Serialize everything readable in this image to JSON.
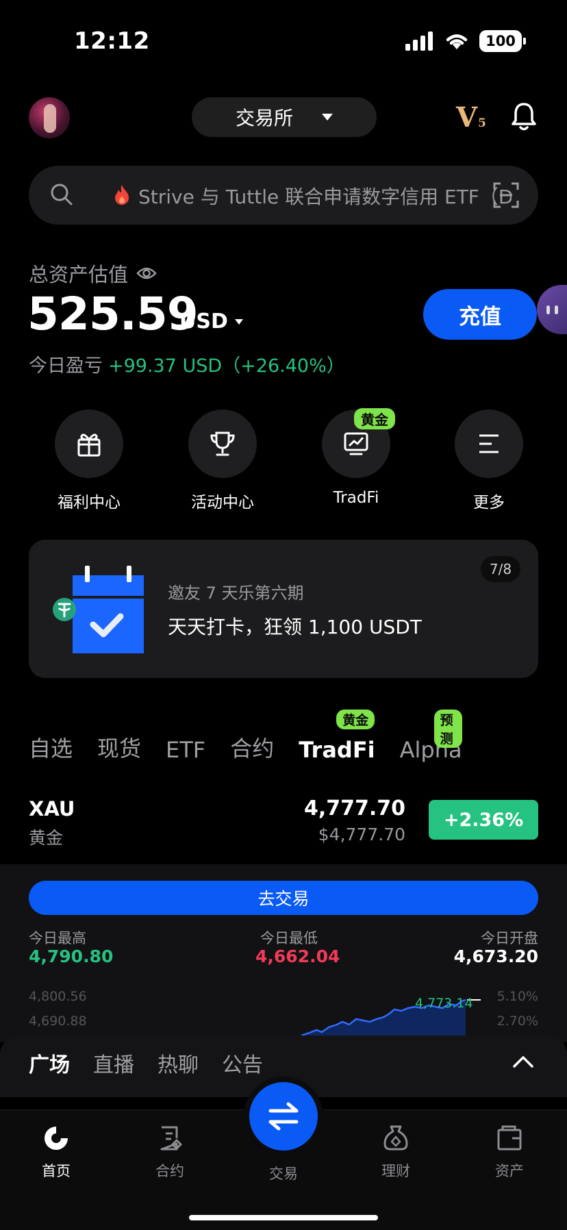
{
  "status_bar": {
    "time": "12:12",
    "battery": "100"
  },
  "header": {
    "mode_label": "交易所",
    "vip_letter": "V",
    "vip_level": "5"
  },
  "search": {
    "text": "Strive 与 Tuttle 联合申请数字信用 ETF（D"
  },
  "assets": {
    "label": "总资产估值",
    "value": "525.59",
    "unit": "USD",
    "pnl_label": "今日盈亏",
    "pnl_value": "+99.37 USD（+26.40%）",
    "deposit_label": "充值"
  },
  "quick_actions": [
    {
      "label": "福利中心",
      "icon": "gift-icon"
    },
    {
      "label": "活动中心",
      "icon": "trophy-icon"
    },
    {
      "label": "TradFi",
      "icon": "chart-monitor-icon",
      "tag": "黄金"
    },
    {
      "label": "更多",
      "icon": "menu-icon"
    }
  ],
  "promo": {
    "counter": "7/8",
    "subtitle": "邀友 7 天乐第六期",
    "title": "天天打卡，狂领 1,100 USDT"
  },
  "market_tabs": [
    {
      "label": "自选"
    },
    {
      "label": "现货"
    },
    {
      "label": "ETF"
    },
    {
      "label": "合约"
    },
    {
      "label": "TradFi",
      "tag": "黄金",
      "active": true
    },
    {
      "label": "Alpha",
      "tag": "预测"
    }
  ],
  "ticker": {
    "symbol": "XAU",
    "name": "黄金",
    "price": "4,777.70",
    "price_usd": "$4,777.70",
    "change": "+2.36%"
  },
  "detail": {
    "trade_button": "去交易",
    "high_label": "今日最高",
    "high_value": "4,790.80",
    "low_label": "今日最低",
    "low_value": "4,662.04",
    "open_label": "今日开盘",
    "open_value": "4,673.20",
    "axis_left": [
      "4,800.56",
      "4,690.88"
    ],
    "axis_right": [
      "5.10%",
      "2.70%"
    ],
    "last_price": "4,773.14"
  },
  "feed_tabs": [
    {
      "label": "广场",
      "active": true
    },
    {
      "label": "直播"
    },
    {
      "label": "热聊"
    },
    {
      "label": "公告"
    }
  ],
  "bottom_nav": [
    {
      "label": "首页",
      "icon": "home-icon",
      "active": true
    },
    {
      "label": "合约",
      "icon": "contract-icon"
    },
    {
      "label": "交易",
      "icon": "swap-icon"
    },
    {
      "label": "理财",
      "icon": "wealth-icon"
    },
    {
      "label": "资产",
      "icon": "wallet-icon"
    }
  ],
  "colors": {
    "accent": "#0a5af5",
    "up": "#26c281",
    "down": "#f23a5a",
    "tag": "#7fe34a",
    "vip": "#e9b77a"
  }
}
